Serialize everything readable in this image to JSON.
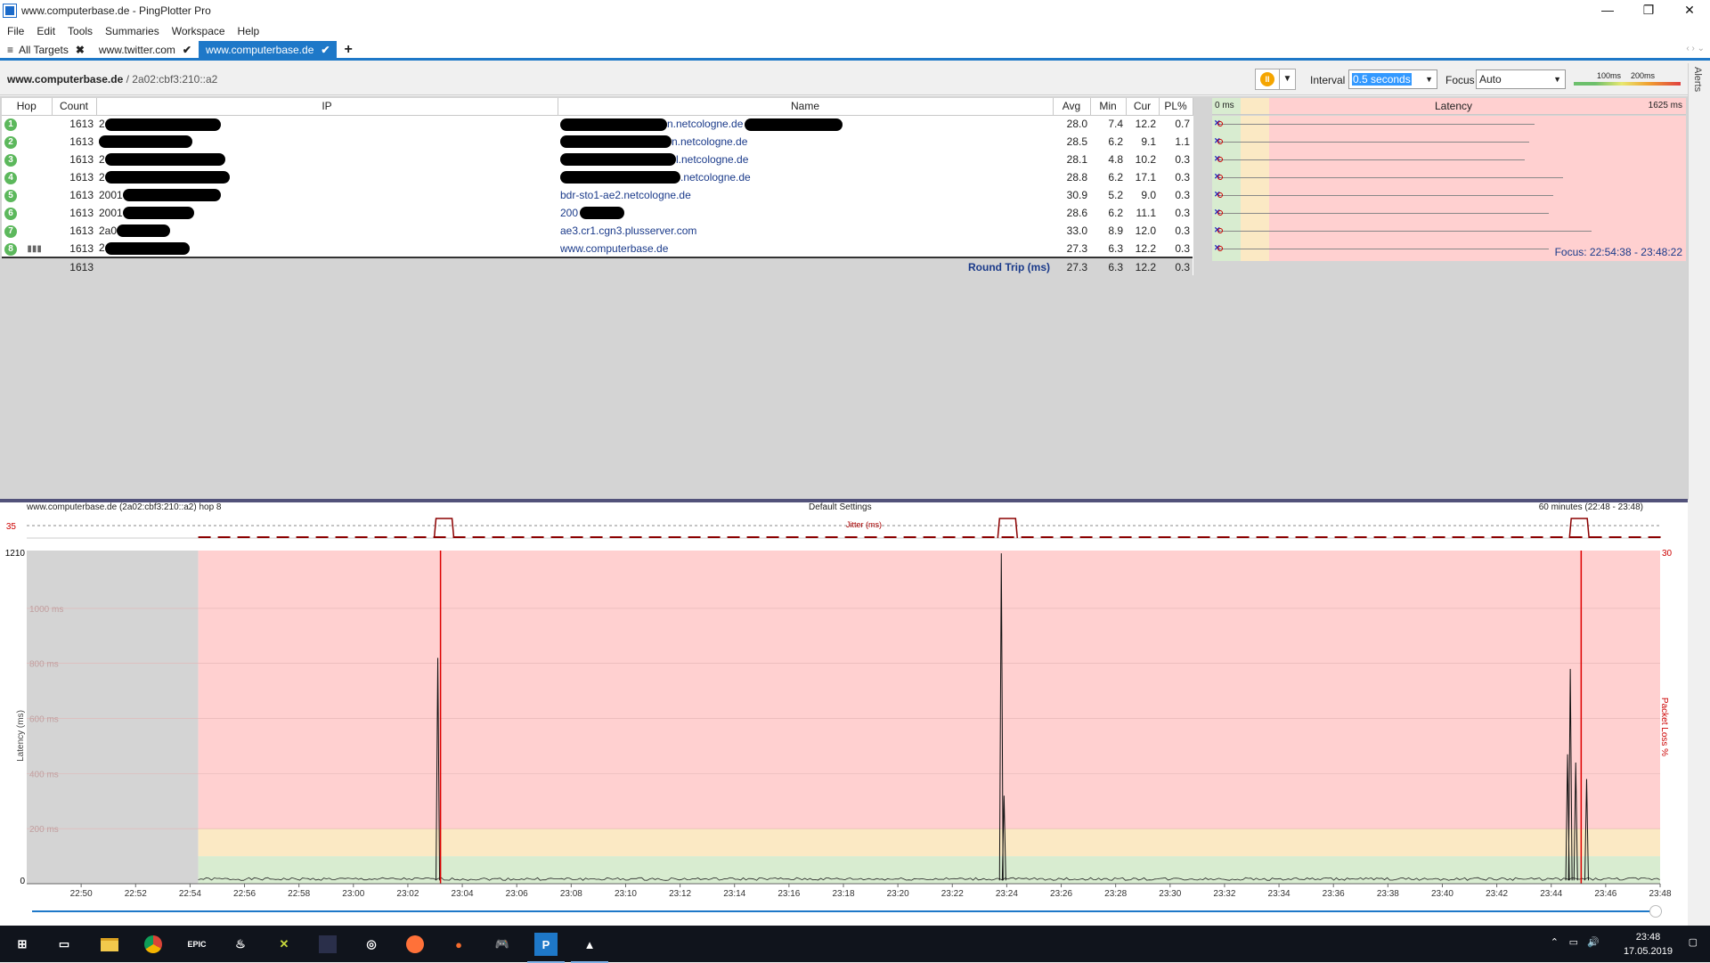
{
  "window": {
    "title": "www.computerbase.de - PingPlotter Pro",
    "minimize": "—",
    "maximize": "❐",
    "close": "✕"
  },
  "menu": [
    "File",
    "Edit",
    "Tools",
    "Summaries",
    "Workspace",
    "Help"
  ],
  "tabs": [
    {
      "label": "All Targets",
      "mark": "✖"
    },
    {
      "label": "www.twitter.com",
      "mark": "✔"
    },
    {
      "label": "www.computerbase.de",
      "mark": "✔"
    }
  ],
  "add_tab": "+",
  "toolbar": {
    "target_host": "www.computerbase.de",
    "target_ip": " / 2a02:cbf3:210::a2",
    "pause_symbol": "II",
    "interval_label": "Interval",
    "interval_value": "0.5 seconds",
    "focus_label": "Focus",
    "focus_value": "Auto",
    "legend_100": "100ms",
    "legend_200": "200ms",
    "alerts": "Alerts"
  },
  "columns": {
    "hop": "Hop",
    "count": "Count",
    "ip": "IP",
    "name": "Name",
    "avg": "Avg",
    "min": "Min",
    "cur": "Cur",
    "pl": "PL%",
    "latency": "Latency",
    "lat_min": "0 ms",
    "lat_max": "1625 ms"
  },
  "hops": [
    {
      "hop": "1",
      "count": "1613",
      "ip_prefix": "2",
      "name_suffix": "n.netcologne.de",
      "avg": "28.0",
      "min": "7.4",
      "cur": "12.2",
      "pl": "0.7",
      "lat_end": 0.68
    },
    {
      "hop": "2",
      "count": "1613",
      "ip_prefix": "",
      "name_suffix": "n.netcologne.de",
      "avg": "28.5",
      "min": "6.2",
      "cur": "9.1",
      "pl": "1.1",
      "lat_end": 0.67
    },
    {
      "hop": "3",
      "count": "1613",
      "ip_prefix": "2",
      "name_suffix": "l.netcologne.de",
      "avg": "28.1",
      "min": "4.8",
      "cur": "10.2",
      "pl": "0.3",
      "lat_end": 0.66
    },
    {
      "hop": "4",
      "count": "1613",
      "ip_prefix": "2",
      "name_suffix": ".netcologne.de",
      "avg": "28.8",
      "min": "6.2",
      "cur": "17.1",
      "pl": "0.3",
      "lat_end": 0.74
    },
    {
      "hop": "5",
      "count": "1613",
      "ip_prefix": "2001",
      "name_suffix": "bdr-sto1-ae2.netcologne.de",
      "avg": "30.9",
      "min": "5.2",
      "cur": "9.0",
      "pl": "0.3",
      "lat_end": 0.72
    },
    {
      "hop": "6",
      "count": "1613",
      "ip_prefix": "2001",
      "name_suffix": "200",
      "avg": "28.6",
      "min": "6.2",
      "cur": "11.1",
      "pl": "0.3",
      "lat_end": 0.71
    },
    {
      "hop": "7",
      "count": "1613",
      "ip_prefix": "2a0",
      "name_suffix": "ae3.cr1.cgn3.plusserver.com",
      "avg": "33.0",
      "min": "8.9",
      "cur": "12.0",
      "pl": "0.3",
      "lat_end": 0.8
    },
    {
      "hop": "8",
      "count": "1613",
      "ip_prefix": "2",
      "name_suffix": "www.computerbase.de",
      "avg": "27.3",
      "min": "6.3",
      "cur": "12.2",
      "pl": "0.3",
      "lat_end": 0.71
    }
  ],
  "summary": {
    "count": "1613",
    "label": "Round Trip (ms)",
    "avg": "27.3",
    "min": "6.3",
    "cur": "12.2",
    "pl": "0.3",
    "focus": "Focus: 22:54:38 - 23:48:22"
  },
  "graph": {
    "target_label": "www.computerbase.de (2a02:cbf3:210::a2) hop 8",
    "settings_label": "Default Settings",
    "range_label": "60 minutes (22:48 - 23:48)",
    "jitter_label": "Jitter (ms)",
    "jitter_max": "35",
    "y_top": "1210",
    "y_zero": "0",
    "y_axis_label": "Latency (ms)",
    "right_axis_label": "Packet Loss %",
    "right_top": "30"
  },
  "chart_data": {
    "type": "line",
    "title": "",
    "ylabel": "Latency (ms)",
    "ylim": [
      0,
      1210
    ],
    "y_ticks": [
      "1000 ms",
      "800 ms",
      "600 ms",
      "400 ms",
      "200 ms"
    ],
    "y_tick_values": [
      1000,
      800,
      600,
      400,
      200
    ],
    "x_ticks": [
      "22:50",
      "22:52",
      "22:54",
      "22:56",
      "22:58",
      "23:00",
      "23:02",
      "23:04",
      "23:06",
      "23:08",
      "23:10",
      "23:12",
      "23:14",
      "23:16",
      "23:18",
      "23:20",
      "23:22",
      "23:24",
      "23:26",
      "23:28",
      "23:30",
      "23:32",
      "23:34",
      "23:36",
      "23:38",
      "23:40",
      "23:42",
      "23:44",
      "23:46",
      "23:48"
    ],
    "x_range_minutes": [
      0,
      60
    ],
    "x_start": "22:48",
    "no_data_until_minute": 6.3,
    "baseline_ms": 12,
    "spikes": [
      {
        "minute": 15.1,
        "ms": 820
      },
      {
        "minute": 35.8,
        "ms": 1200
      },
      {
        "minute": 35.9,
        "ms": 320
      },
      {
        "minute": 56.7,
        "ms": 780
      },
      {
        "minute": 56.6,
        "ms": 470
      },
      {
        "minute": 56.9,
        "ms": 440
      },
      {
        "minute": 57.3,
        "ms": 380
      }
    ],
    "loss_markers_minutes": [
      15.2,
      57.1
    ],
    "zones": [
      {
        "to_ms": 100,
        "color": "#d8ecd0"
      },
      {
        "to_ms": 200,
        "color": "#fbe9c4"
      },
      {
        "to_ms": 1210,
        "color": "#ffd0d0"
      }
    ]
  },
  "taskbar": {
    "time": "23:48",
    "date": "17.05.2019",
    "apps": [
      "windows-start",
      "task-view",
      "file-explorer",
      "chrome",
      "epic-games",
      "steam",
      "app-x",
      "app-dark",
      "app-circle",
      "firefox",
      "origin",
      "app-gamepad",
      "pingplotter",
      "photos"
    ]
  }
}
